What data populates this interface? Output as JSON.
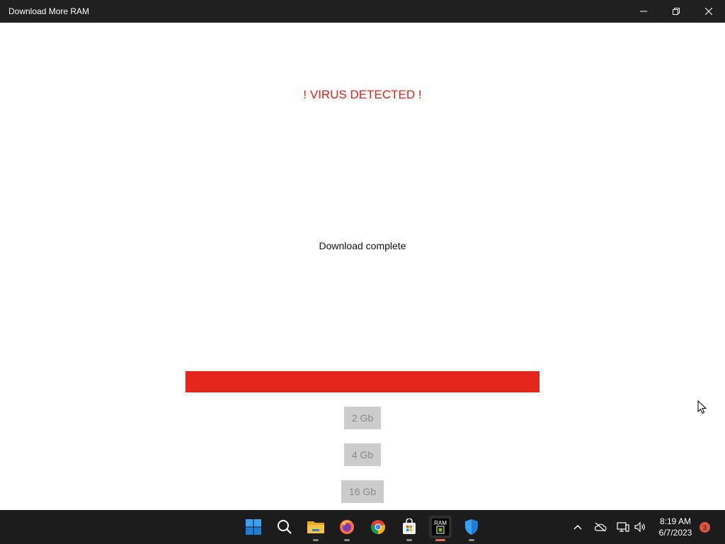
{
  "window": {
    "title": "Download More RAM",
    "controls": [
      "minimize-icon",
      "restore-icon",
      "close-icon"
    ]
  },
  "main": {
    "alert_text": "! VIRUS DETECTED !",
    "status_text": "Download complete",
    "progress_percent": 100,
    "progress_color": "#e4251a",
    "alert_color": "#e0201a",
    "buttons": [
      {
        "label": "2 Gb",
        "enabled": false
      },
      {
        "label": "4 Gb",
        "enabled": false
      },
      {
        "label": "16 Gb",
        "enabled": false
      }
    ]
  },
  "taskbar": {
    "apps": [
      "start-icon",
      "search-icon",
      "file-explorer-icon",
      "firefox-icon",
      "chrome-icon",
      "microsoft-store-icon",
      "ram-app-icon",
      "defender-icon"
    ],
    "active_app": "ram-app-icon",
    "ram_icon_label": "RAM",
    "tray": [
      "chevron-up-icon",
      "onedrive-offline-icon",
      "network-icon",
      "volume-icon"
    ],
    "time": "8:19 AM",
    "date": "6/7/2023",
    "notification_count": "3"
  }
}
